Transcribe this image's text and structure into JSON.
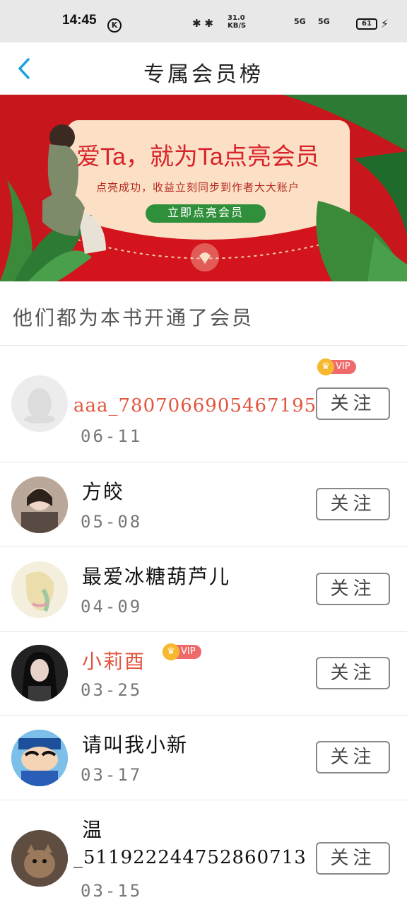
{
  "status_bar": {
    "time": "14:45",
    "k_icon": "K",
    "network_speed": "31.0 KB/S",
    "signal_1": "5G",
    "signal_2": "5G",
    "battery": "61"
  },
  "header": {
    "back_icon": "chevron-left",
    "title": "专属会员榜"
  },
  "banner": {
    "headline": "爱Ta，就为Ta点亮会员",
    "subline": "点亮成功，收益立刻同步到作者大大账户",
    "cta": "立即点亮会员"
  },
  "section": {
    "title": "他们都为本书开通了会员"
  },
  "vip_label": "VIP",
  "follow_label": "关注",
  "members": [
    {
      "name": "aaa_780706690546719​5",
      "date": "06-11",
      "vip": true
    },
    {
      "name": "方皎",
      "date": "05-08",
      "vip": false
    },
    {
      "name": "最爱冰糖葫芦儿",
      "date": "04-09",
      "vip": false
    },
    {
      "name": "小莉酉",
      "date": "03-25",
      "vip": true
    },
    {
      "name": "请叫我小新",
      "date": "03-17",
      "vip": false
    },
    {
      "name_line1": "温",
      "name_line2": "_5119222447528607​13",
      "date": "03-15",
      "vip": false
    }
  ],
  "colors": {
    "accent_blue": "#1aa0e0",
    "banner_red": "#c8161d",
    "vip_name": "#e2553e",
    "vip_badge": "#ef6b6b",
    "cta_green": "#2f8f3a"
  }
}
